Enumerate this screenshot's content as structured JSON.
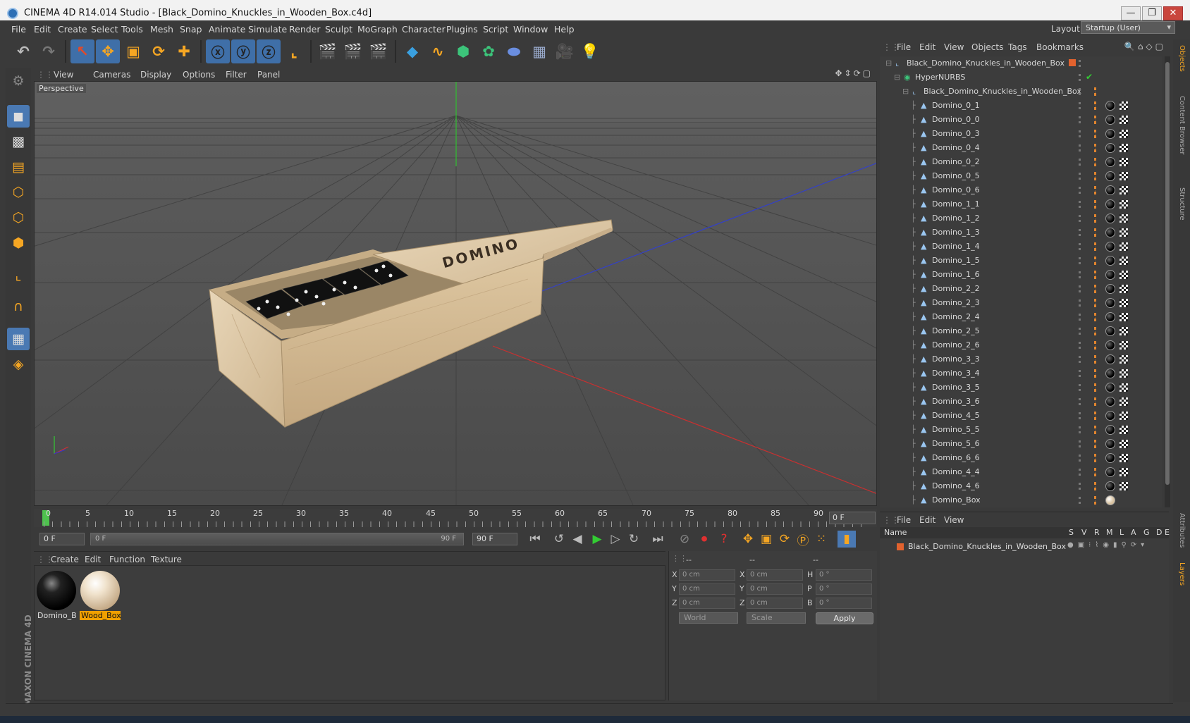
{
  "window": {
    "title": "CINEMA 4D R14.014 Studio - [Black_Domino_Knuckles_in_Wooden_Box.c4d]",
    "minimize": "—",
    "maximize": "❐",
    "close": "✕"
  },
  "menu": [
    "File",
    "Edit",
    "Create",
    "Select",
    "Tools",
    "Mesh",
    "Snap",
    "Animate",
    "Simulate",
    "Render",
    "Sculpt",
    "MoGraph",
    "Character",
    "Plugins",
    "Script",
    "Window",
    "Help"
  ],
  "layout": {
    "label": "Layout:",
    "value": "Startup (User)"
  },
  "viewport": {
    "menu": [
      "View",
      "Cameras",
      "Display",
      "Options",
      "Filter",
      "Panel"
    ],
    "camera_label": "Perspective",
    "box_text": "DOMINO"
  },
  "timeline": {
    "ticks": [
      "0",
      "5",
      "10",
      "15",
      "20",
      "25",
      "30",
      "35",
      "40",
      "45",
      "50",
      "55",
      "60",
      "65",
      "70",
      "75",
      "80",
      "85",
      "90"
    ],
    "current_frame": "0 F"
  },
  "transport": {
    "start_field": "0 F",
    "range_start": "0 F",
    "range_end": "90 F",
    "end_field": "90 F"
  },
  "materials": {
    "menu": [
      "Create",
      "Edit",
      "Function",
      "Texture"
    ],
    "items": [
      {
        "label": "Domino_Bl",
        "selected": false
      },
      {
        "label": "Wood_Box",
        "selected": true
      }
    ]
  },
  "coordinates": {
    "headers": [
      "--",
      "--",
      "--"
    ],
    "rows": [
      {
        "a": "X",
        "av": "0 cm",
        "b": "X",
        "bv": "0 cm",
        "c": "H",
        "cv": "0 °"
      },
      {
        "a": "Y",
        "av": "0 cm",
        "b": "Y",
        "bv": "0 cm",
        "c": "P",
        "cv": "0 °"
      },
      {
        "a": "Z",
        "av": "0 cm",
        "b": "Z",
        "bv": "0 cm",
        "c": "B",
        "cv": "0 °"
      }
    ],
    "mode1": "World",
    "mode2": "Scale",
    "apply": "Apply"
  },
  "objects": {
    "menu": [
      "File",
      "Edit",
      "View",
      "Objects",
      "Tags",
      "Bookmarks"
    ],
    "items": [
      {
        "name": "Black_Domino_Knuckles_in_Wooden_Box",
        "indent": 0
      },
      {
        "name": "HyperNURBS",
        "indent": 1
      },
      {
        "name": "Black_Domino_Knuckles_in_Wooden_Box",
        "indent": 2
      },
      {
        "name": "Domino_0_1",
        "indent": 3
      },
      {
        "name": "Domino_0_0",
        "indent": 3
      },
      {
        "name": "Domino_0_3",
        "indent": 3
      },
      {
        "name": "Domino_0_4",
        "indent": 3
      },
      {
        "name": "Domino_0_2",
        "indent": 3
      },
      {
        "name": "Domino_0_5",
        "indent": 3
      },
      {
        "name": "Domino_0_6",
        "indent": 3
      },
      {
        "name": "Domino_1_1",
        "indent": 3
      },
      {
        "name": "Domino_1_2",
        "indent": 3
      },
      {
        "name": "Domino_1_3",
        "indent": 3
      },
      {
        "name": "Domino_1_4",
        "indent": 3
      },
      {
        "name": "Domino_1_5",
        "indent": 3
      },
      {
        "name": "Domino_1_6",
        "indent": 3
      },
      {
        "name": "Domino_2_2",
        "indent": 3
      },
      {
        "name": "Domino_2_3",
        "indent": 3
      },
      {
        "name": "Domino_2_4",
        "indent": 3
      },
      {
        "name": "Domino_2_5",
        "indent": 3
      },
      {
        "name": "Domino_2_6",
        "indent": 3
      },
      {
        "name": "Domino_3_3",
        "indent": 3
      },
      {
        "name": "Domino_3_4",
        "indent": 3
      },
      {
        "name": "Domino_3_5",
        "indent": 3
      },
      {
        "name": "Domino_3_6",
        "indent": 3
      },
      {
        "name": "Domino_4_5",
        "indent": 3
      },
      {
        "name": "Domino_5_5",
        "indent": 3
      },
      {
        "name": "Domino_5_6",
        "indent": 3
      },
      {
        "name": "Domino_6_6",
        "indent": 3
      },
      {
        "name": "Domino_4_4",
        "indent": 3
      },
      {
        "name": "Domino_4_6",
        "indent": 3
      },
      {
        "name": "Domino_Box",
        "indent": 3
      }
    ]
  },
  "layers": {
    "menu": [
      "File",
      "Edit",
      "View"
    ],
    "col_name": "Name",
    "cols": [
      "S",
      "V",
      "R",
      "M",
      "L",
      "A",
      "G",
      "D",
      "E"
    ],
    "row": "Black_Domino_Knuckles_in_Wooden_Box"
  },
  "side_tabs": [
    "Objects",
    "Content Browser",
    "Structure",
    "Attributes",
    "Layers"
  ],
  "brand": "MAXON CINEMA 4D",
  "colors": {
    "accent": "#3f6fa8",
    "selected_material": "#f0a000",
    "axis_x": "#c03030",
    "axis_y": "#30b030",
    "axis_z": "#3040c0"
  }
}
